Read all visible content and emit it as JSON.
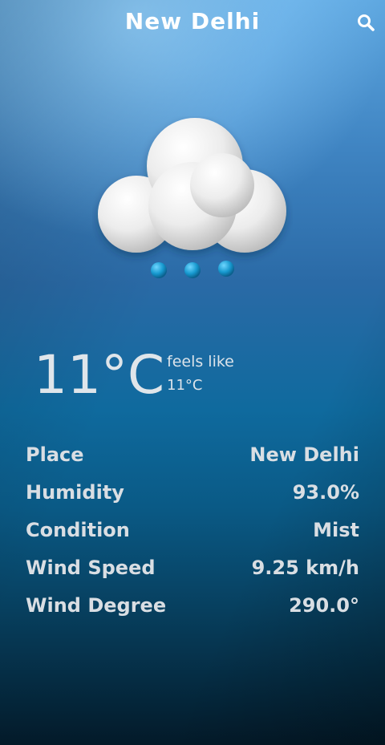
{
  "header": {
    "title": "New Delhi",
    "search_icon": "search-icon"
  },
  "weather": {
    "icon": "cloud-rain-icon",
    "temperature": "11°C",
    "feels_like_label": "feels like",
    "feels_like_value": "11°C"
  },
  "details": [
    {
      "label": "Place",
      "value": "New Delhi"
    },
    {
      "label": "Humidity",
      "value": "93.0%"
    },
    {
      "label": "Condition",
      "value": "Mist"
    },
    {
      "label": "Wind Speed",
      "value": "9.25 km/h"
    },
    {
      "label": "Wind Degree",
      "value": "290.0°"
    }
  ],
  "colors": {
    "sky_top": "#8fd0ff",
    "sky_mid": "#0f6a9e",
    "sky_bottom": "#031a29",
    "cloud": "#f1f1f1",
    "drop": "#1aa3d9"
  }
}
